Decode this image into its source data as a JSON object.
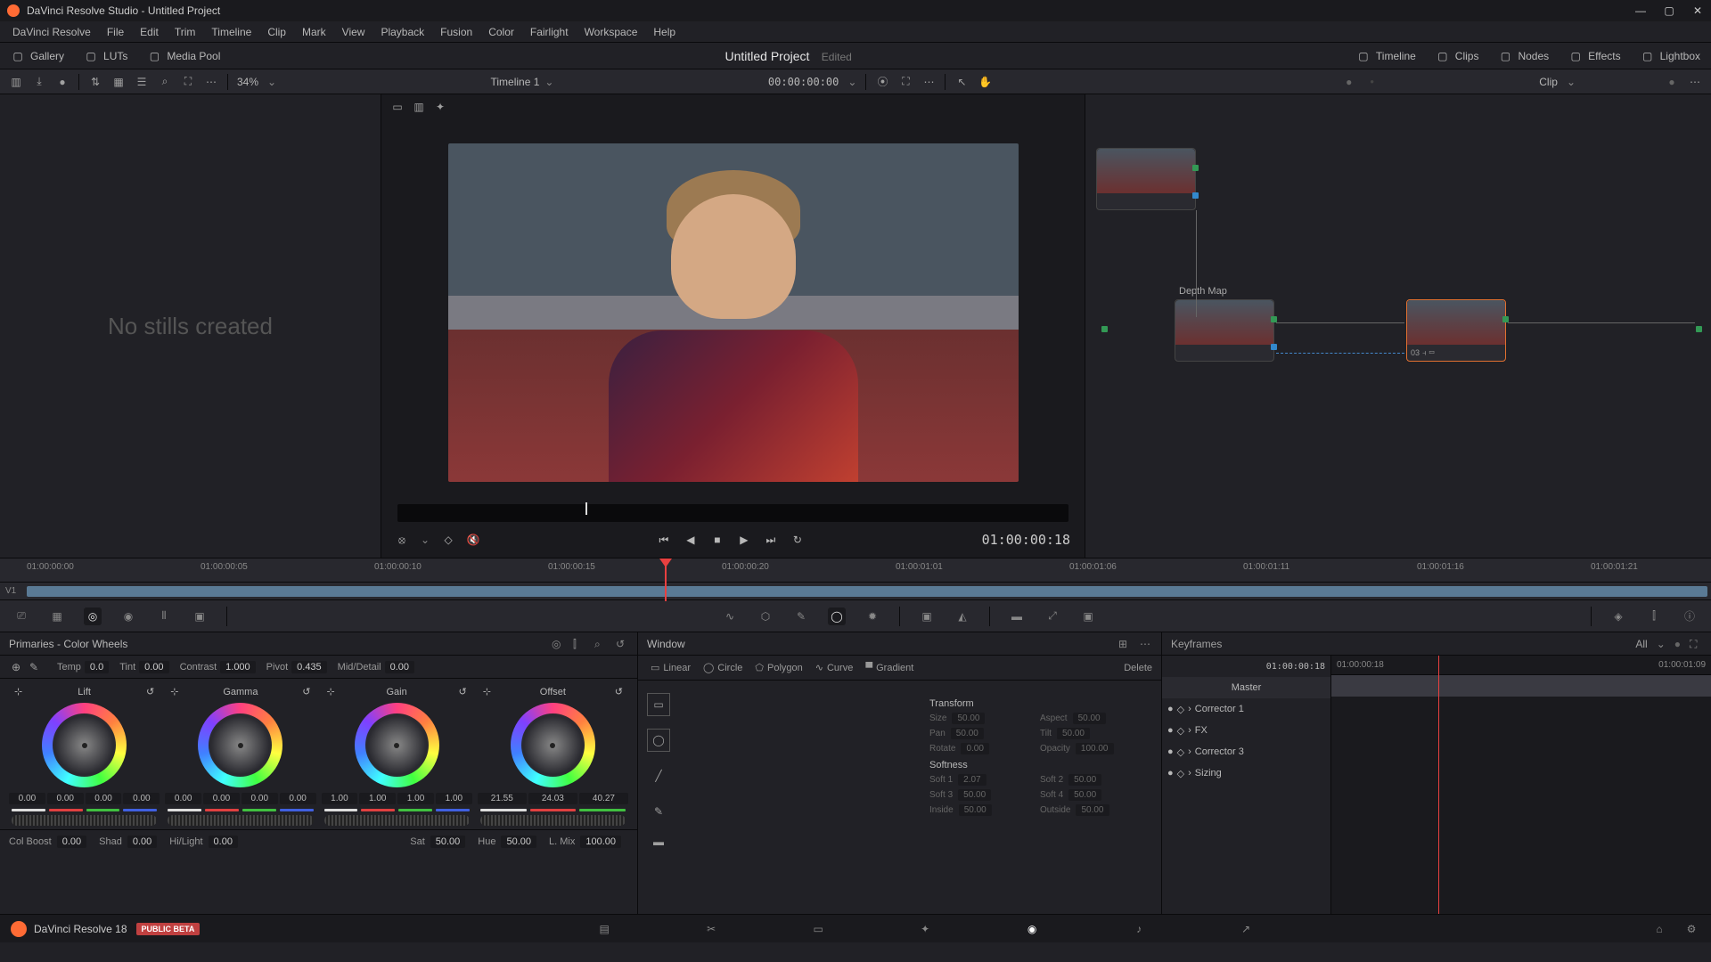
{
  "titlebar": {
    "title": "DaVinci Resolve Studio - Untitled Project"
  },
  "menu": [
    "DaVinci Resolve",
    "File",
    "Edit",
    "Trim",
    "Timeline",
    "Clip",
    "Mark",
    "View",
    "Playback",
    "Fusion",
    "Color",
    "Fairlight",
    "Workspace",
    "Help"
  ],
  "toolbar1": {
    "left": [
      {
        "icon": "gallery-icon",
        "label": "Gallery"
      },
      {
        "icon": "luts-icon",
        "label": "LUTs"
      },
      {
        "icon": "mediapool-icon",
        "label": "Media Pool"
      }
    ],
    "project_title": "Untitled Project",
    "project_status": "Edited",
    "right": [
      {
        "icon": "timeline-icon",
        "label": "Timeline"
      },
      {
        "icon": "clips-icon",
        "label": "Clips"
      },
      {
        "icon": "nodes-icon",
        "label": "Nodes"
      },
      {
        "icon": "effects-icon",
        "label": "Effects"
      },
      {
        "icon": "lightbox-icon",
        "label": "Lightbox"
      }
    ]
  },
  "toolbar2": {
    "zoom": "34%",
    "timeline_name": "Timeline 1",
    "timecode": "00:00:00:00",
    "clip_mode": "Clip"
  },
  "gallery": {
    "empty_msg": "No stills created"
  },
  "viewer": {
    "timecode": "01:00:00:18"
  },
  "nodes": {
    "label_depth": "Depth Map",
    "node3_id": "03"
  },
  "timeline": {
    "ticks": [
      "01:00:00:00",
      "01:00:00:05",
      "01:00:00:10",
      "01:00:00:15",
      "01:00:00:20",
      "01:00:01:01",
      "01:00:01:06",
      "01:00:01:11",
      "01:00:01:16",
      "01:00:01:21"
    ],
    "track": "V1"
  },
  "primaries": {
    "title": "Primaries - Color Wheels",
    "temp_lbl": "Temp",
    "temp_val": "0.0",
    "tint_lbl": "Tint",
    "tint_val": "0.00",
    "contrast_lbl": "Contrast",
    "contrast_val": "1.000",
    "pivot_lbl": "Pivot",
    "pivot_val": "0.435",
    "md_lbl": "Mid/Detail",
    "md_val": "0.00",
    "wheels": [
      {
        "name": "Lift",
        "vals": [
          "0.00",
          "0.00",
          "0.00",
          "0.00"
        ]
      },
      {
        "name": "Gamma",
        "vals": [
          "0.00",
          "0.00",
          "0.00",
          "0.00"
        ]
      },
      {
        "name": "Gain",
        "vals": [
          "1.00",
          "1.00",
          "1.00",
          "1.00"
        ]
      },
      {
        "name": "Offset",
        "vals": [
          "21.55",
          "24.03",
          "40.27",
          ""
        ]
      }
    ],
    "colboost_lbl": "Col Boost",
    "colboost_val": "0.00",
    "shad_lbl": "Shad",
    "shad_val": "0.00",
    "hilight_lbl": "Hi/Light",
    "hilight_val": "0.00",
    "sat_lbl": "Sat",
    "sat_val": "50.00",
    "hue_lbl": "Hue",
    "hue_val": "50.00",
    "lmix_lbl": "L. Mix",
    "lmix_val": "100.00"
  },
  "window": {
    "title": "Window",
    "shapes": [
      "Linear",
      "Circle",
      "Polygon",
      "Curve",
      "Gradient"
    ],
    "delete": "Delete",
    "transform": {
      "title": "Transform",
      "size_lbl": "Size",
      "size_val": "50.00",
      "aspect_lbl": "Aspect",
      "aspect_val": "50.00",
      "pan_lbl": "Pan",
      "pan_val": "50.00",
      "tilt_lbl": "Tilt",
      "tilt_val": "50.00",
      "rotate_lbl": "Rotate",
      "rotate_val": "0.00",
      "opacity_lbl": "Opacity",
      "opacity_val": "100.00"
    },
    "softness": {
      "title": "Softness",
      "s1_lbl": "Soft 1",
      "s1_val": "2.07",
      "s2_lbl": "Soft 2",
      "s2_val": "50.00",
      "s3_lbl": "Soft 3",
      "s3_val": "50.00",
      "s4_lbl": "Soft 4",
      "s4_val": "50.00",
      "in_lbl": "Inside",
      "in_val": "50.00",
      "out_lbl": "Outside",
      "out_val": "50.00"
    }
  },
  "keyframes": {
    "title": "Keyframes",
    "mode": "All",
    "tc": [
      "01:00:00:18",
      "01:00:00:18",
      "01:00:01:09"
    ],
    "master": "Master",
    "items": [
      "Corrector 1",
      "FX",
      "Corrector 3",
      "Sizing"
    ]
  },
  "footer": {
    "app_name": "DaVinci Resolve 18",
    "badge": "PUBLIC BETA"
  }
}
